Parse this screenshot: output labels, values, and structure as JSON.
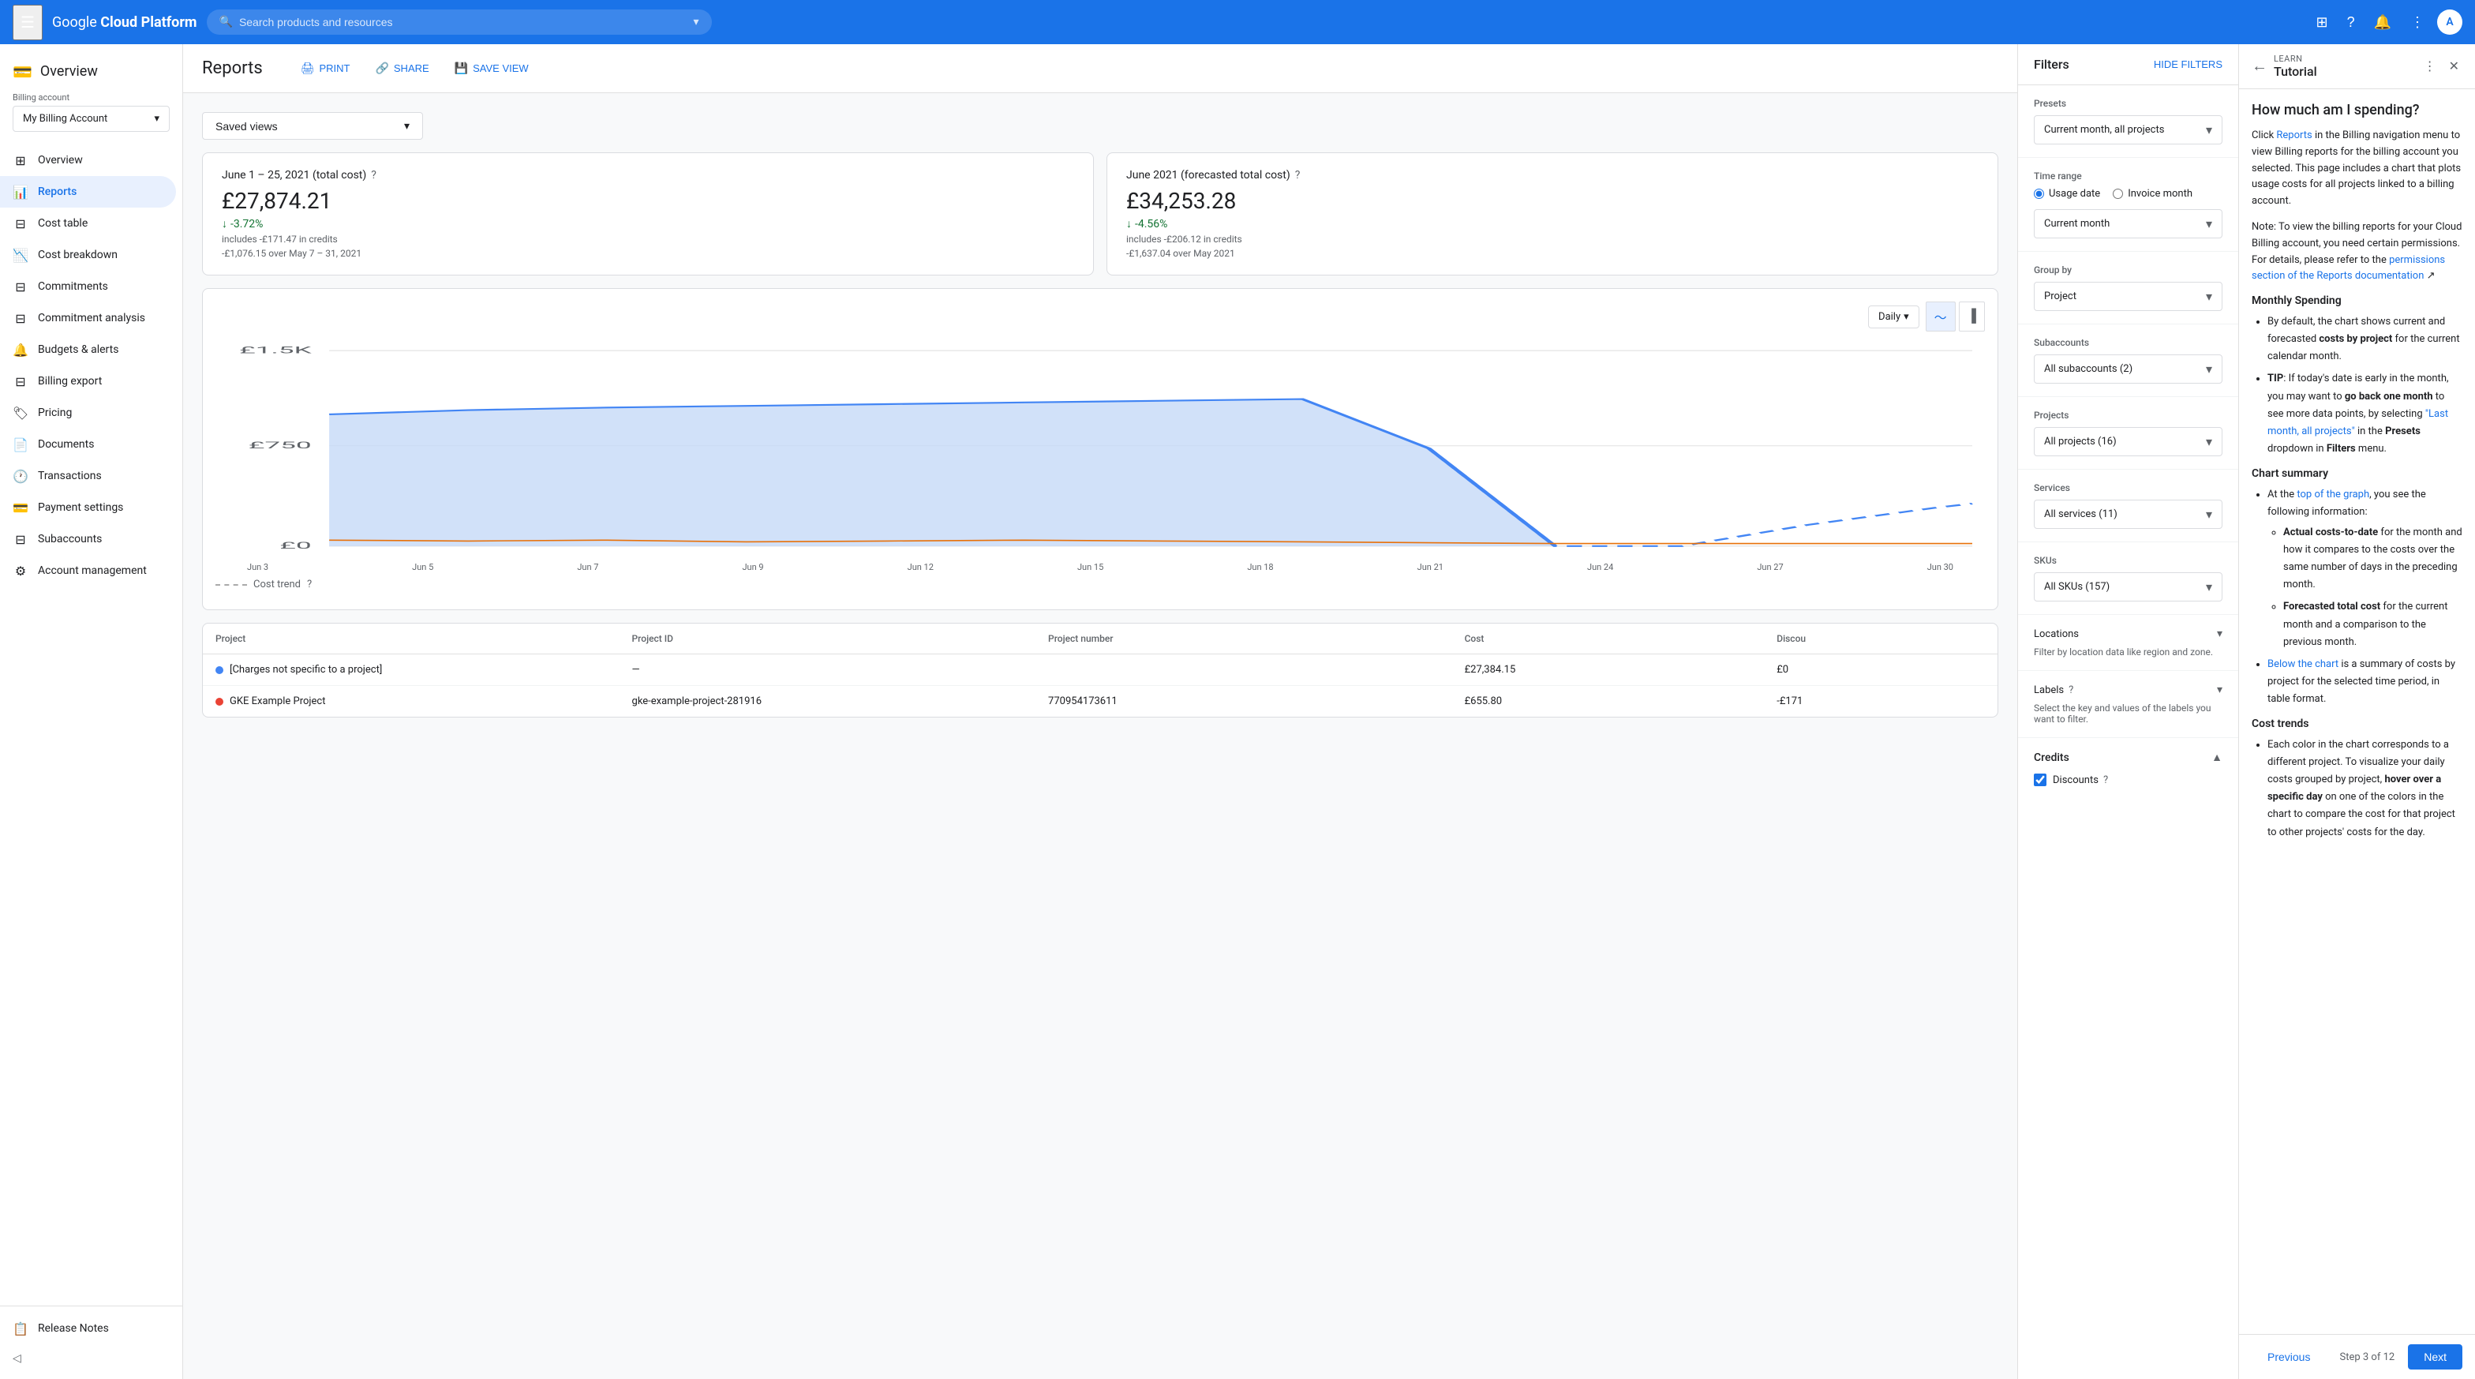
{
  "topnav": {
    "logo": "Google Cloud Platform",
    "search_placeholder": "Search products and resources"
  },
  "sidebar": {
    "billing_label": "Billing account",
    "billing_account": "My Billing Account",
    "nav_items": [
      {
        "id": "overview",
        "label": "Overview",
        "icon": "⊞"
      },
      {
        "id": "reports",
        "label": "Reports",
        "icon": "📊",
        "active": true
      },
      {
        "id": "cost-table",
        "label": "Cost table",
        "icon": "⊟"
      },
      {
        "id": "cost-breakdown",
        "label": "Cost breakdown",
        "icon": "📉"
      },
      {
        "id": "commitments",
        "label": "Commitments",
        "icon": "⊟"
      },
      {
        "id": "commitment-analysis",
        "label": "Commitment analysis",
        "icon": "⊟"
      },
      {
        "id": "budgets-alerts",
        "label": "Budgets & alerts",
        "icon": "🔔"
      },
      {
        "id": "billing-export",
        "label": "Billing export",
        "icon": "⊟"
      },
      {
        "id": "pricing",
        "label": "Pricing",
        "icon": "🏷"
      },
      {
        "id": "documents",
        "label": "Documents",
        "icon": "📄"
      },
      {
        "id": "transactions",
        "label": "Transactions",
        "icon": "🕐"
      },
      {
        "id": "payment-settings",
        "label": "Payment settings",
        "icon": "💳"
      },
      {
        "id": "subaccounts",
        "label": "Subaccounts",
        "icon": "⊟"
      },
      {
        "id": "account-management",
        "label": "Account management",
        "icon": "⚙"
      }
    ],
    "bottom_items": [
      {
        "id": "release-notes",
        "label": "Release Notes",
        "icon": "📋"
      }
    ]
  },
  "reports": {
    "title": "Reports",
    "actions": {
      "print": "PRINT",
      "share": "SHARE",
      "save_view": "SAVE VIEW"
    },
    "saved_views": "Saved views",
    "stats": [
      {
        "period": "June 1 – 25, 2021 (total cost)",
        "amount": "£27,874.21",
        "change": "-3.72%",
        "note1": "includes -£171.47 in credits",
        "note2": "-£1,076.15 over May 7 – 31, 2021"
      },
      {
        "period": "June 2021 (forecasted total cost)",
        "amount": "£34,253.28",
        "change": "-4.56%",
        "note1": "includes -£206.12 in credits",
        "note2": "-£1,637.04 over May 2021"
      }
    ],
    "chart": {
      "period_label": "Daily",
      "y_labels": [
        "£1.5K",
        "£750",
        "£0"
      ],
      "x_labels": [
        "Jun 3",
        "Jun 5",
        "Jun 7",
        "Jun 9",
        "Jun 12",
        "Jun 15",
        "Jun 18",
        "Jun 21",
        "Jun 24",
        "Jun 27",
        "Jun 30"
      ]
    },
    "cost_trend_label": "Cost trend",
    "table": {
      "headers": [
        "Project",
        "Project ID",
        "Project number",
        "Cost",
        "Discou"
      ],
      "rows": [
        {
          "dot_color": "#4285f4",
          "project": "[Charges not specific to a project]",
          "project_id": "—",
          "project_number": "",
          "cost": "£27,384.15",
          "discount": "£0"
        },
        {
          "dot_color": "#ea4335",
          "project": "GKE Example Project",
          "project_id": "gke-example-project-281916",
          "project_number": "770954173611",
          "cost": "£655.80",
          "discount": "-£171"
        }
      ]
    }
  },
  "filters": {
    "title": "Filters",
    "hide_btn": "HIDE FILTERS",
    "presets_label": "Presets",
    "presets_value": "Current month, all projects",
    "time_range_label": "Time range",
    "time_range_options": [
      "Usage date",
      "Invoice month"
    ],
    "time_range_selected": "Usage date",
    "current_month_label": "Current month",
    "group_by_label": "Group by",
    "group_by_value": "Project",
    "subaccounts_label": "Subaccounts",
    "subaccounts_value": "All subaccounts (2)",
    "projects_label": "Projects",
    "projects_value": "All projects (16)",
    "services_label": "Services",
    "services_value": "All services (11)",
    "skus_label": "SKUs",
    "skus_value": "All SKUs (157)",
    "locations_label": "Locations",
    "locations_note": "Filter by location data like region and zone.",
    "labels_label": "Labels",
    "labels_note": "Select the key and values of the labels you want to filter.",
    "credits_title": "Credits",
    "discounts_label": "Discounts",
    "discounts_checked": true
  },
  "tutorial": {
    "learn_label": "LEARN",
    "title": "Tutorial",
    "main_title": "How much am I spending?",
    "intro": "Click Reports in the Billing navigation menu to view Billing reports for the billing account you selected. This page includes a chart that plots usage costs for all projects linked to a billing account.",
    "note": "Note: To view the billing reports for your Cloud Billing account, you need certain permissions. For details, please refer to the permissions section of the Reports documentation",
    "sections": [
      {
        "title": "Monthly Spending",
        "items": [
          "By default, the chart shows current and forecasted costs by project for the current calendar month.",
          "TIP: If today's date is early in the month, you may want to go back one month to see more data points, by selecting \"Last month, all projects\" in the Presets dropdown in Filters menu."
        ]
      },
      {
        "title": "Chart summary",
        "items": [
          "At the top of the graph, you see the following information:",
          "Actual costs-to-date for the month and how it compares to the costs over the same number of days in the preceding month.",
          "Forecasted total cost for the current month and a comparison to the previous month.",
          "Below the chart is a summary of costs by project for the selected time period, in table format."
        ]
      },
      {
        "title": "Cost trends",
        "items": [
          "Each color in the chart corresponds to a different project. To visualize your daily costs grouped by project, hover over a specific day on one of the colors in the chart to compare the cost for that project to other projects' costs for the day."
        ]
      }
    ],
    "footer": {
      "prev_label": "Previous",
      "step_label": "Step 3 of 12",
      "next_label": "Next"
    }
  }
}
